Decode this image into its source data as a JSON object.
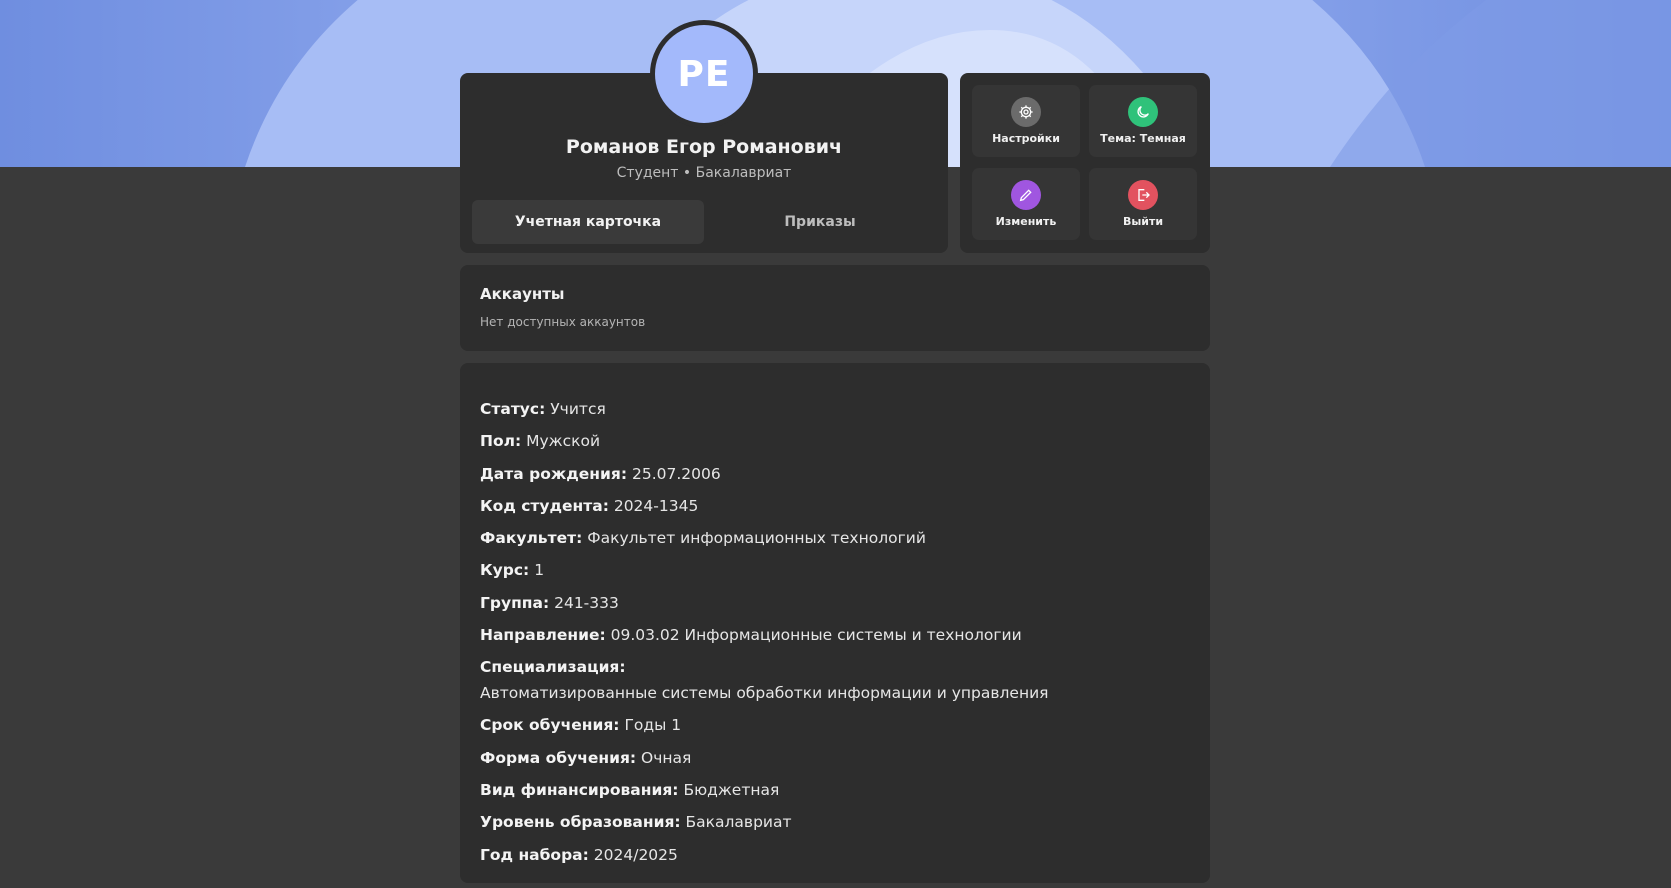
{
  "profile": {
    "initials": "РЕ",
    "name": "Романов Егор Романович",
    "role": "Студент • Бакалавриат",
    "tabs": [
      {
        "label": "Учетная карточка",
        "active": true
      },
      {
        "label": "Приказы",
        "active": false
      }
    ]
  },
  "actions": [
    {
      "label": "Настройки",
      "icon": "gear-icon",
      "color": "#6b6b6b"
    },
    {
      "label": "Тема: Темная",
      "icon": "moon-icon",
      "color": "#2fc27a"
    },
    {
      "label": "Изменить",
      "icon": "pencil-icon",
      "color": "#a056e0"
    },
    {
      "label": "Выйти",
      "icon": "logout-icon",
      "color": "#e2525f"
    }
  ],
  "accounts": {
    "title": "Аккаунты",
    "empty": "Нет доступных аккаунтов"
  },
  "info": [
    {
      "key": "Статус:",
      "value": "Учится"
    },
    {
      "key": "Пол:",
      "value": "Мужской"
    },
    {
      "key": "Дата рождения:",
      "value": "25.07.2006"
    },
    {
      "key": "Код студента:",
      "value": "2024-1345"
    },
    {
      "key": "Факультет:",
      "value": "Факультет информационных технологий"
    },
    {
      "key": "Курс:",
      "value": "1"
    },
    {
      "key": "Группа:",
      "value": "241-333"
    },
    {
      "key": "Направление:",
      "value": "09.03.02 Информационные системы и технологии"
    },
    {
      "key": "Специализация:",
      "value": "Автоматизированные системы обработки информации и управления"
    },
    {
      "key": "Срок обучения:",
      "value": "Годы 1"
    },
    {
      "key": "Форма обучения:",
      "value": "Очная"
    },
    {
      "key": "Вид финансирования:",
      "value": "Бюджетная"
    },
    {
      "key": "Уровень образования:",
      "value": "Бакалавриат"
    },
    {
      "key": "Год набора:",
      "value": "2024/2025"
    }
  ],
  "colors": {
    "background": "#3a3a3a",
    "card": "#2d2d2d",
    "banner": "#8faaf0",
    "avatar": "#a3b9fb"
  }
}
